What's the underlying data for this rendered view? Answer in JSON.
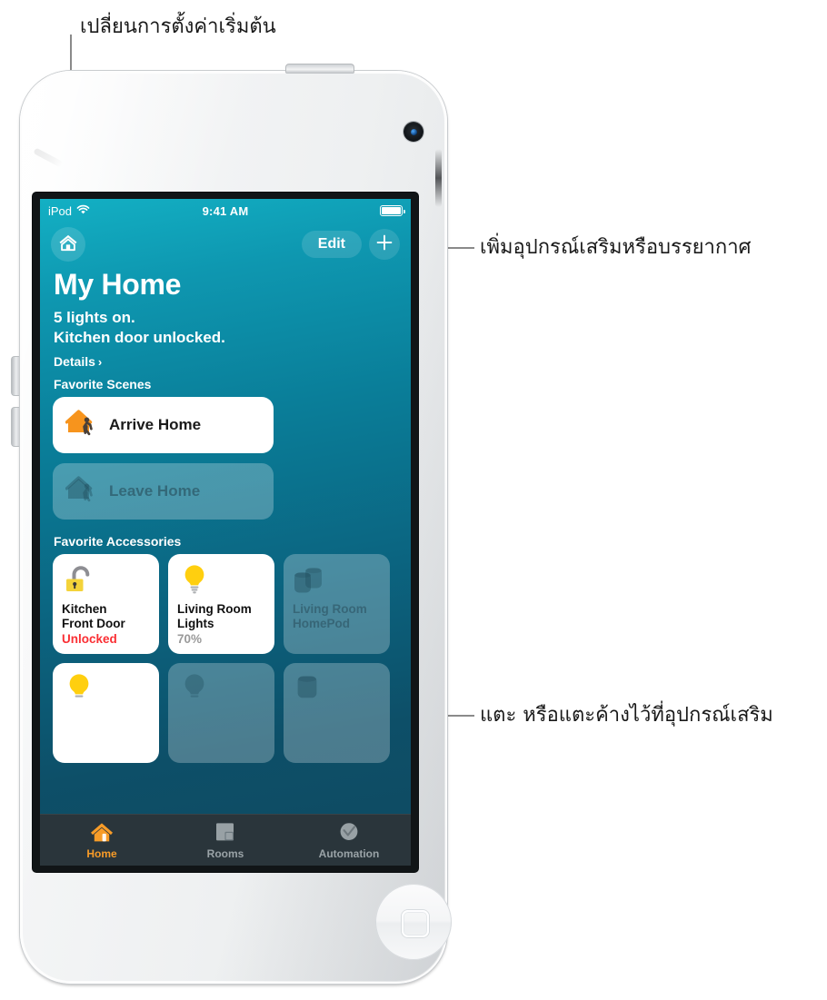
{
  "annotations": [
    {
      "id": "change-default-settings",
      "text": "เปลี่ยนการตั้งค่าเริ่มต้น"
    },
    {
      "id": "add-accessory-or-scene",
      "text": "เพิ่มอุปกรณ์เสริมหรือบรรยากาศ"
    },
    {
      "id": "tap-or-press-accessory",
      "text": "แตะ หรือแตะค้างไว้ที่อุปกรณ์เสริม"
    }
  ],
  "device": {
    "name": "iPod touch"
  },
  "status_bar": {
    "carrier": "iPod",
    "wifi_icon": "wifi-icon",
    "time": "9:41 AM",
    "battery_icon": "battery-full-icon"
  },
  "nav": {
    "home_icon": "house-icon",
    "edit_label": "Edit",
    "add_icon": "plus-icon"
  },
  "header": {
    "title": "My Home",
    "status_lines": [
      "5 lights on.",
      "Kitchen door unlocked."
    ],
    "details_label": "Details",
    "details_chevron": "›"
  },
  "sections": {
    "scenes_title": "Favorite Scenes",
    "accessories_title": "Favorite Accessories"
  },
  "scenes": [
    {
      "label": "Arrive Home",
      "state": "on",
      "icon": "house-walk-in-icon"
    },
    {
      "label": "Leave Home",
      "state": "off",
      "icon": "house-walk-out-icon"
    }
  ],
  "accessories": [
    {
      "name": "Kitchen\nFront Door",
      "name_line1": "Kitchen",
      "name_line2": "Front Door",
      "state": "Unlocked",
      "state_style": "alert",
      "tile_state": "on",
      "icon": "unlocked-padlock-icon"
    },
    {
      "name_line1": "Living Room",
      "name_line2": "Lights",
      "state": "70%",
      "state_style": "muted",
      "tile_state": "on",
      "icon": "lightbulb-icon"
    },
    {
      "name_line1": "Living Room",
      "name_line2": "HomePod",
      "state": "",
      "state_style": "",
      "tile_state": "off",
      "icon": "homepod-icon"
    },
    {
      "name_line1": "",
      "name_line2": "",
      "state": "",
      "state_style": "",
      "tile_state": "on",
      "icon": "lightbulb-icon"
    },
    {
      "name_line1": "",
      "name_line2": "",
      "state": "",
      "state_style": "",
      "tile_state": "off",
      "icon": "lightbulb-icon"
    },
    {
      "name_line1": "",
      "name_line2": "",
      "state": "",
      "state_style": "",
      "tile_state": "off",
      "icon": "homepod-icon"
    }
  ],
  "tabs": [
    {
      "label": "Home",
      "icon": "house-icon",
      "active": true
    },
    {
      "label": "Rooms",
      "icon": "rooms-grid-icon",
      "active": false
    },
    {
      "label": "Automation",
      "icon": "clock-check-icon",
      "active": false
    }
  ],
  "colors": {
    "accent_orange": "#f89c28",
    "alert_red": "#fa2f34",
    "bulb_yellow": "#ffcf0f",
    "gradient_top": "#13b0c4",
    "gradient_bottom": "#0f4a61",
    "tabbar": "#2c3438"
  }
}
